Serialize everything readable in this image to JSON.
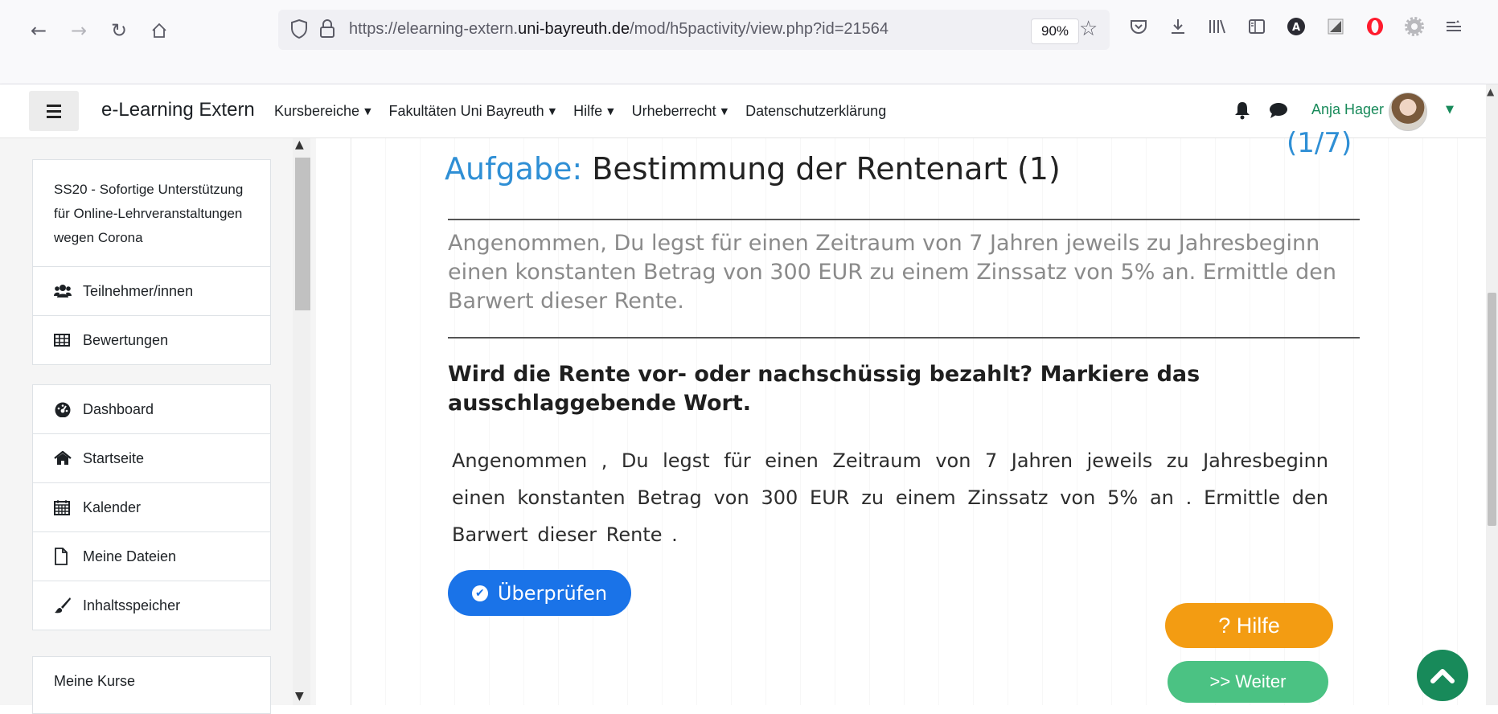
{
  "browser": {
    "url_prefix": "https://elearning-extern.",
    "url_domain": "uni-bayreuth.de",
    "url_path": "/mod/h5pactivity/view.php?id=21564",
    "zoom": "90%"
  },
  "navbar": {
    "brand": "e-Learning Extern",
    "menu": [
      {
        "label": "Kursbereiche",
        "dropdown": true
      },
      {
        "label": "Fakultäten Uni Bayreuth",
        "dropdown": true
      },
      {
        "label": "Hilfe",
        "dropdown": true
      },
      {
        "label": "Urheberrecht",
        "dropdown": true
      },
      {
        "label": "Datenschutzerklärung",
        "dropdown": false
      }
    ],
    "user_name": "Anja Hager"
  },
  "drawer": {
    "course": {
      "title": "SS20 - Sofortige Unterstützung für Online-Lehrveranstaltungen wegen Corona",
      "items": [
        {
          "label": "Teilnehmer/innen",
          "icon": "users-icon"
        },
        {
          "label": "Bewertungen",
          "icon": "table-icon"
        }
      ]
    },
    "site": {
      "items": [
        {
          "label": "Dashboard",
          "icon": "dashboard-icon"
        },
        {
          "label": "Startseite",
          "icon": "home-icon"
        },
        {
          "label": "Kalender",
          "icon": "calendar-icon"
        },
        {
          "label": "Meine Dateien",
          "icon": "file-icon"
        },
        {
          "label": "Inhaltsspeicher",
          "icon": "paintbrush-icon"
        }
      ]
    },
    "my_courses_label": "Meine Kurse"
  },
  "task": {
    "label": "Aufgabe:",
    "title": "Bestimmung der Rentenart (1)",
    "counter": "(1/7)",
    "intro": "Angenommen, Du legst für einen Zeitraum von 7 Jahren jeweils zu Jahresbeginn einen konstanten Betrag von 300 EUR zu einem Zinssatz von 5% an. Ermittle den Barwert dieser Rente.",
    "question": "Wird die Rente vor- oder nachschüssig bezahlt? Markiere das ausschlaggebende Wort.",
    "answer_text": "Angenommen , Du legst für einen Zeitraum von 7 Jahren jeweils zu Jahresbeginn einen konstanten Betrag von 300 EUR zu einem Zinssatz von 5% an . Ermittle den Barwert dieser Rente .",
    "check_label": "Überprüfen",
    "help_label": "? Hilfe",
    "next_label": ">> Weiter"
  },
  "colors": {
    "accent_blue": "#2f8fd5",
    "button_blue": "#1a73e8",
    "help_orange": "#f39c12",
    "next_green": "#4bc283",
    "brand_green": "#188a5a"
  }
}
